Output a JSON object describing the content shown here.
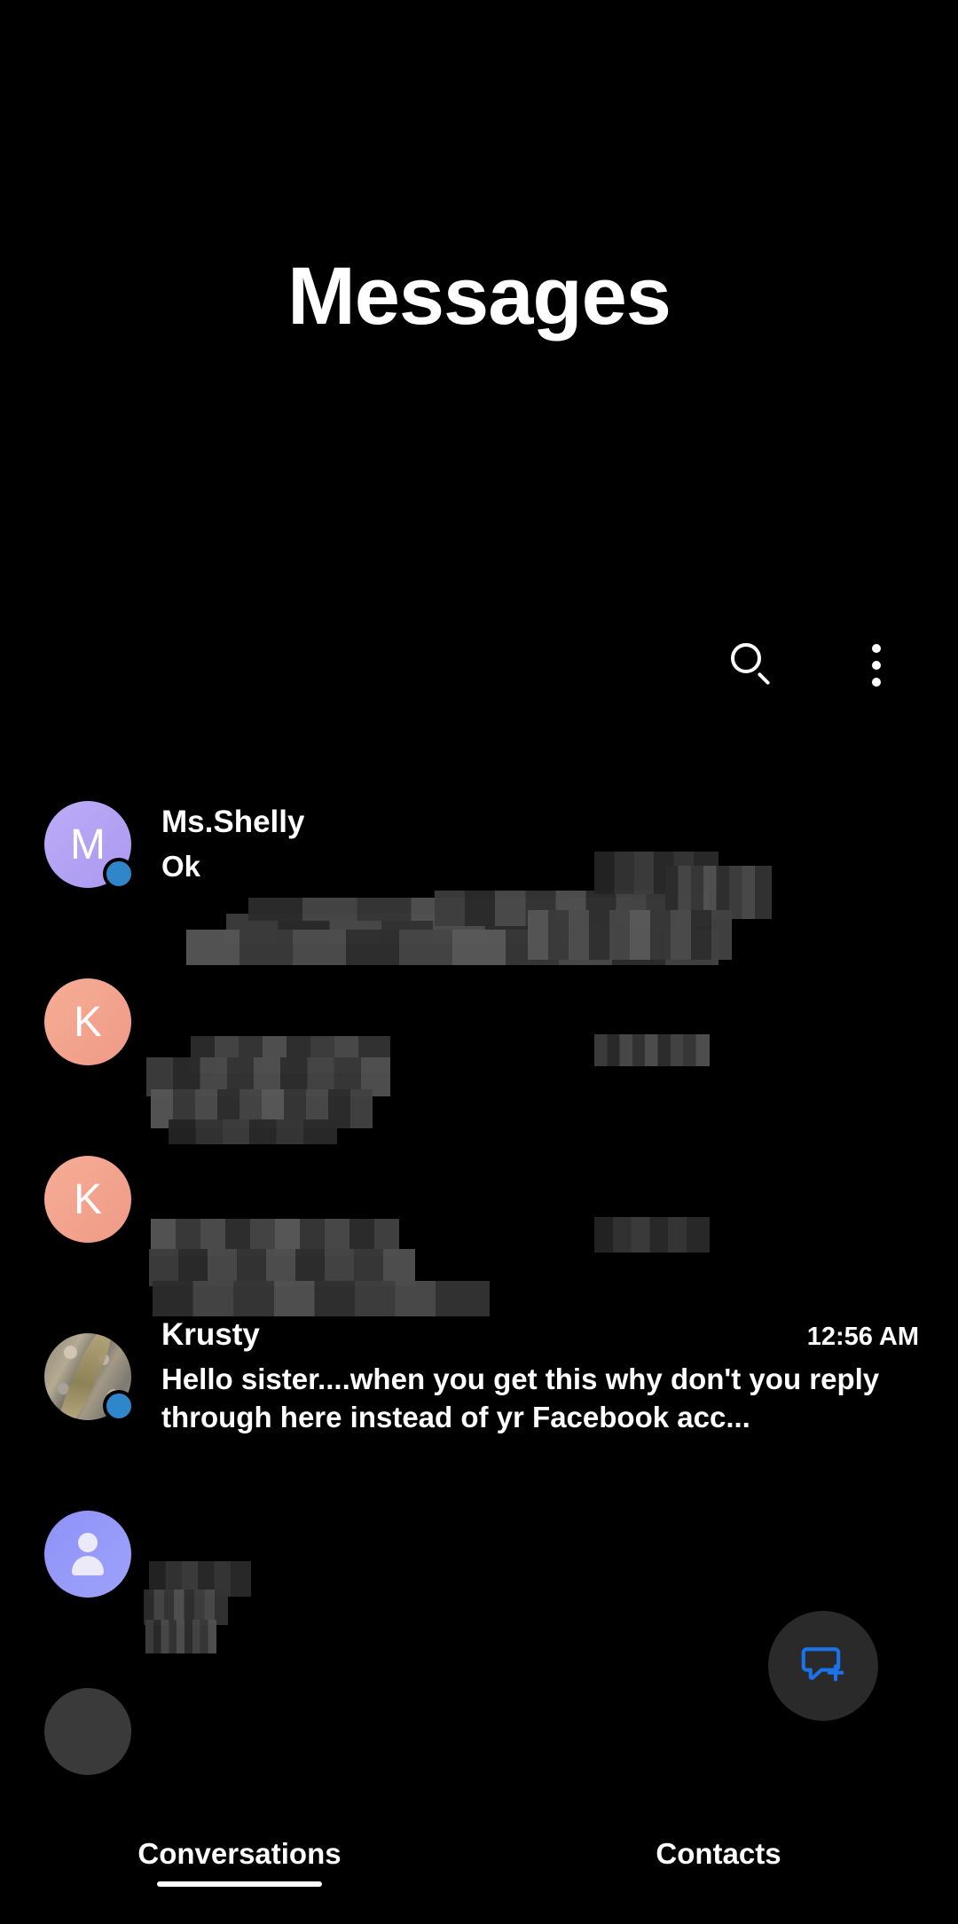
{
  "app": {
    "title": "Messages",
    "background_color": "#000000",
    "accent_color": "#1a73e8"
  },
  "actions": {
    "search_icon": "search-icon",
    "overflow_icon": "more-vertical-icon"
  },
  "conversations": [
    {
      "avatar": {
        "type": "initial",
        "letter": "M",
        "color": "#b4a4f2"
      },
      "name": "Ms.Shelly",
      "preview": "Ok",
      "time": "",
      "online": true,
      "redacted": true
    },
    {
      "avatar": {
        "type": "initial",
        "letter": "K",
        "color": "#f4a48f"
      },
      "name": "",
      "preview": "",
      "time": "",
      "online": false,
      "redacted": true
    },
    {
      "avatar": {
        "type": "initial",
        "letter": "K",
        "color": "#f4a48f"
      },
      "name": "",
      "preview": "",
      "time": "",
      "online": false,
      "redacted": true
    },
    {
      "avatar": {
        "type": "photo",
        "letter": "",
        "color": "#8c8578"
      },
      "name": "Krusty",
      "preview": "Hello sister....when you get this why don't you reply through here instead of yr Facebook acc...",
      "time": "12:56 AM",
      "online": true,
      "redacted": false
    },
    {
      "avatar": {
        "type": "person",
        "letter": "",
        "color": "#9296f9"
      },
      "name": "",
      "preview": "",
      "time": "",
      "online": false,
      "redacted": true
    },
    {
      "avatar": {
        "type": "person",
        "letter": "",
        "color": "#3a3a3a"
      },
      "name": "",
      "preview": "",
      "time": "",
      "online": false,
      "redacted": true
    }
  ],
  "fab": {
    "label": "New conversation",
    "icon": "new-message-icon",
    "icon_color": "#1a73e8",
    "background_color": "#2a2a2a"
  },
  "tabs": [
    {
      "label": "Conversations",
      "active": true
    },
    {
      "label": "Contacts",
      "active": false
    }
  ]
}
